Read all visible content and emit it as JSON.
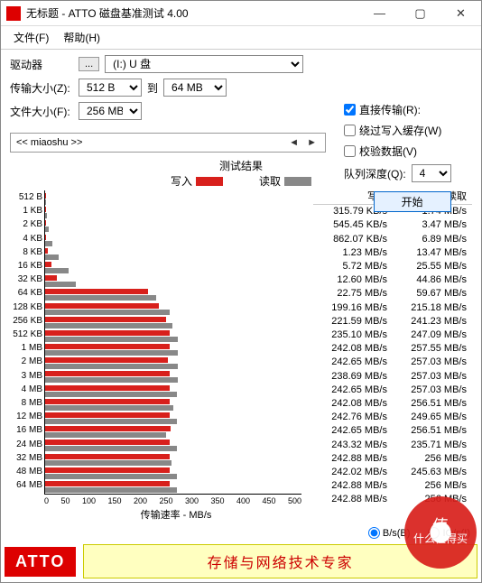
{
  "title": "无标题 - ATTO 磁盘基准测试 4.00",
  "menu": {
    "file": "文件(F)",
    "help": "帮助(H)"
  },
  "labels": {
    "drive": "驱动器",
    "browse": "...",
    "drive_value": "(I:) U 盘",
    "transfer_size": "传输大小(Z):",
    "ts_from": "512 B",
    "to": "到",
    "ts_to": "64 MB",
    "file_size": "文件大小(F):",
    "fs_value": "256 MB",
    "direct_io": "直接传输(R):",
    "bypass_cache": "绕过写入缓存(W)",
    "verify": "校验数据(V)",
    "queue_depth": "队列深度(Q):",
    "qd_value": "4",
    "start": "开始",
    "desc": "<< miaoshu >>",
    "results_title": "测试结果",
    "write": "写入",
    "read": "读取",
    "x_label": "传输速率 - MB/s",
    "unit_bs": "B/s(B)",
    "unit_ios": "IO/s(I)"
  },
  "footer": {
    "brand": "ATTO",
    "tagline": "存储与网络技术专家"
  },
  "watermark": {
    "line1": "值",
    "line2": "什么值得买"
  },
  "x_ticks": [
    "0",
    "50",
    "100",
    "150",
    "200",
    "250",
    "300",
    "350",
    "400",
    "450",
    "500"
  ],
  "chart_data": {
    "type": "bar",
    "title": "测试结果",
    "xlabel": "传输速率 - MB/s",
    "ylabel": "",
    "xlim": [
      0,
      500
    ],
    "categories": [
      "512 B",
      "1 KB",
      "2 KB",
      "4 KB",
      "8 KB",
      "16 KB",
      "32 KB",
      "64 KB",
      "128 KB",
      "256 KB",
      "512 KB",
      "1 MB",
      "2 MB",
      "3 MB",
      "4 MB",
      "8 MB",
      "12 MB",
      "16 MB",
      "24 MB",
      "32 MB",
      "48 MB",
      "64 MB"
    ],
    "series": [
      {
        "name": "写入",
        "unit": "MB/s",
        "display": [
          "315.79 KB/s",
          "545.45 KB/s",
          "862.07 KB/s",
          "1.23 MB/s",
          "5.72 MB/s",
          "12.60 MB/s",
          "22.75 MB/s",
          "199.16 MB/s",
          "221.59 MB/s",
          "235.10 MB/s",
          "242.08 MB/s",
          "242.65 MB/s",
          "238.69 MB/s",
          "242.65 MB/s",
          "242.08 MB/s",
          "242.76 MB/s",
          "242.65 MB/s",
          "243.32 MB/s",
          "242.88 MB/s",
          "242.02 MB/s",
          "242.88 MB/s",
          "242.88 MB/s"
        ],
        "values_mb": [
          0.31,
          0.53,
          0.84,
          1.23,
          5.72,
          12.6,
          22.75,
          199.16,
          221.59,
          235.1,
          242.08,
          242.65,
          238.69,
          242.65,
          242.08,
          242.76,
          242.65,
          243.32,
          242.88,
          242.02,
          242.88,
          242.88
        ]
      },
      {
        "name": "读取",
        "unit": "MB/s",
        "display": [
          "1.74 MB/s",
          "3.47 MB/s",
          "6.89 MB/s",
          "13.47 MB/s",
          "25.55 MB/s",
          "44.86 MB/s",
          "59.67 MB/s",
          "215.18 MB/s",
          "241.23 MB/s",
          "247.09 MB/s",
          "257.55 MB/s",
          "257.03 MB/s",
          "257.03 MB/s",
          "257.03 MB/s",
          "256.51 MB/s",
          "249.65 MB/s",
          "256.51 MB/s",
          "235.71 MB/s",
          "256 MB/s",
          "245.63 MB/s",
          "256 MB/s",
          "256 MB/s"
        ],
        "values_mb": [
          1.74,
          3.47,
          6.89,
          13.47,
          25.55,
          44.86,
          59.67,
          215.18,
          241.23,
          247.09,
          257.55,
          257.03,
          257.03,
          257.03,
          256.51,
          249.65,
          256.51,
          235.71,
          256,
          245.63,
          256,
          256
        ]
      }
    ]
  }
}
